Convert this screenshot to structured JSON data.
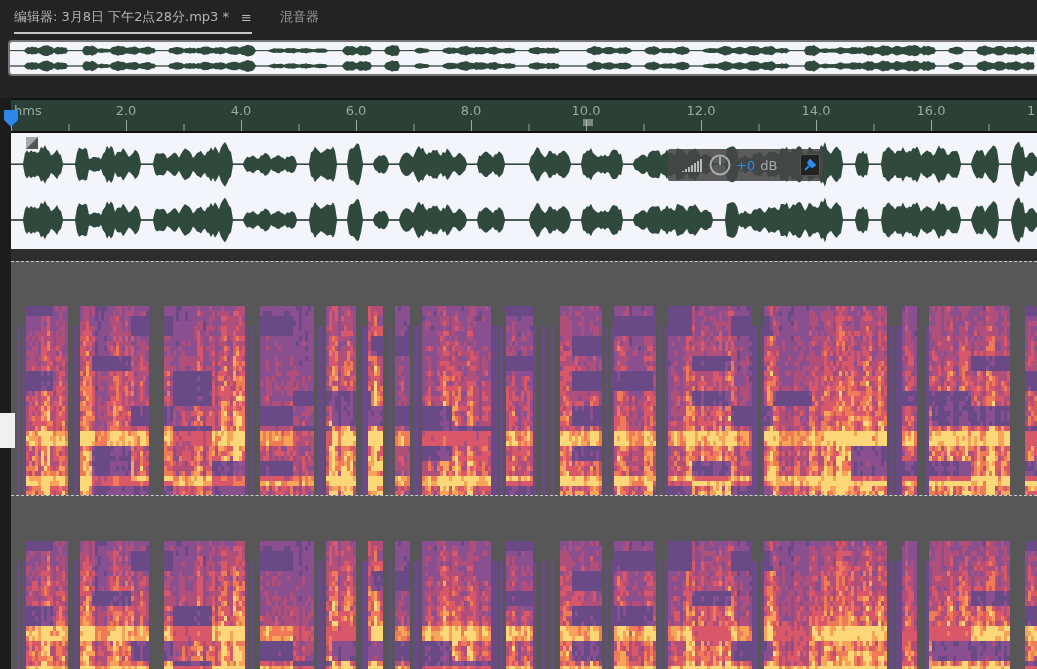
{
  "tabs": [
    {
      "label": "编辑器: 3月8日 下午2点28分.mp3 *",
      "selected": true,
      "menu": "≡"
    },
    {
      "label": "混音器",
      "selected": false
    }
  ],
  "ruler": {
    "labels": [
      "hms",
      "2.0",
      "4.0",
      "6.0",
      "8.0",
      "10.0",
      "12.0",
      "14.0",
      "16.0",
      "1"
    ]
  },
  "hud": {
    "gain": "+0",
    "unit": "dB"
  }
}
